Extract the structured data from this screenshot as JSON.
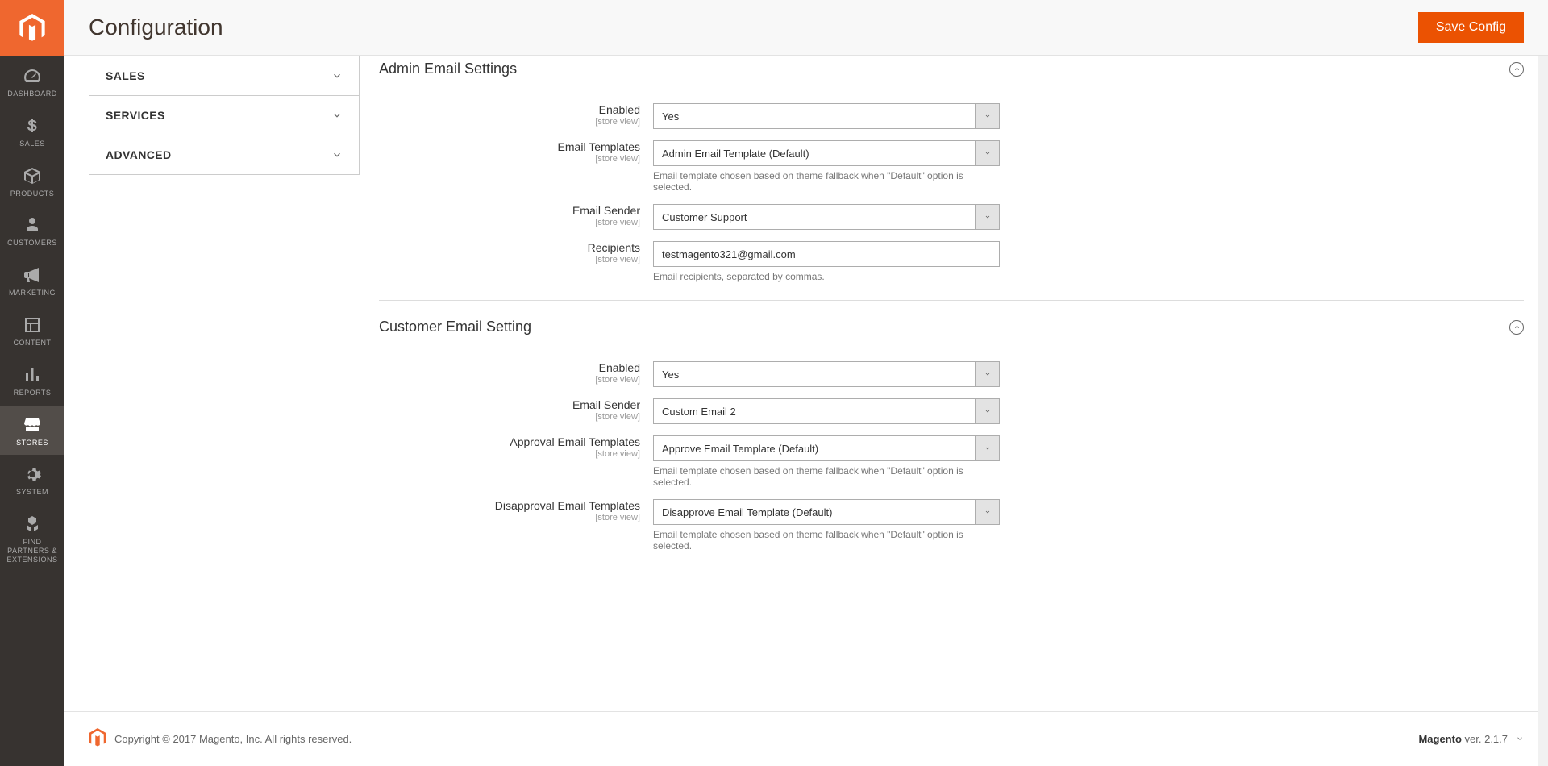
{
  "nav": {
    "items": [
      {
        "label": "DASHBOARD",
        "name": "nav-dashboard"
      },
      {
        "label": "SALES",
        "name": "nav-sales"
      },
      {
        "label": "PRODUCTS",
        "name": "nav-products"
      },
      {
        "label": "CUSTOMERS",
        "name": "nav-customers"
      },
      {
        "label": "MARKETING",
        "name": "nav-marketing"
      },
      {
        "label": "CONTENT",
        "name": "nav-content"
      },
      {
        "label": "REPORTS",
        "name": "nav-reports"
      },
      {
        "label": "STORES",
        "name": "nav-stores",
        "active": true
      },
      {
        "label": "SYSTEM",
        "name": "nav-system"
      },
      {
        "label": "FIND PARTNERS & EXTENSIONS",
        "name": "nav-partners"
      }
    ]
  },
  "header": {
    "title": "Configuration",
    "save_btn": "Save Config"
  },
  "tabs": [
    {
      "label": "SALES"
    },
    {
      "label": "SERVICES"
    },
    {
      "label": "ADVANCED"
    }
  ],
  "scope_label": "[store view]",
  "sections": {
    "admin": {
      "title": "Admin Email Settings",
      "fields": {
        "enabled": {
          "label": "Enabled",
          "value": "Yes"
        },
        "templates": {
          "label": "Email Templates",
          "value": "Admin Email Template (Default)",
          "hint": "Email template chosen based on theme fallback when \"Default\" option is selected."
        },
        "sender": {
          "label": "Email Sender",
          "value": "Customer Support"
        },
        "recipients": {
          "label": "Recipients",
          "value": "testmagento321@gmail.com",
          "hint": "Email recipients, separated by commas."
        }
      }
    },
    "customer": {
      "title": "Customer Email Setting",
      "fields": {
        "enabled": {
          "label": "Enabled",
          "value": "Yes"
        },
        "sender": {
          "label": "Email Sender",
          "value": "Custom Email 2"
        },
        "approval": {
          "label": "Approval Email Templates",
          "value": "Approve Email Template (Default)",
          "hint": "Email template chosen based on theme fallback when \"Default\" option is selected."
        },
        "disapproval": {
          "label": "Disapproval Email Templates",
          "value": "Disapprove Email Template (Default)",
          "hint": "Email template chosen based on theme fallback when \"Default\" option is selected."
        }
      }
    }
  },
  "footer": {
    "copyright": "Copyright © 2017 Magento, Inc. All rights reserved.",
    "brand": "Magento",
    "version": " ver. 2.1.7"
  }
}
